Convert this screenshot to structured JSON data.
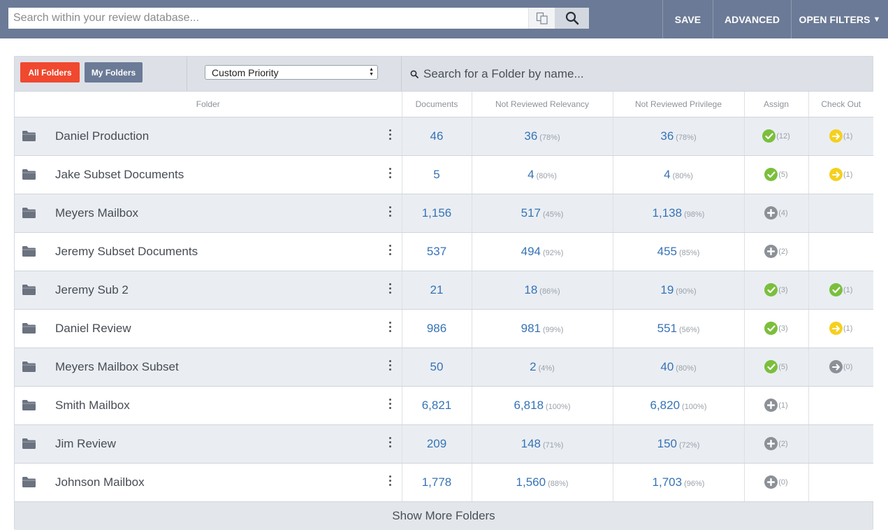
{
  "search": {
    "placeholder": "Search within your review database..."
  },
  "top_actions": {
    "save": "SAVE",
    "advanced": "ADVANCED",
    "open_filters": "OPEN FILTERS"
  },
  "toolbar": {
    "all_folders": "All Folders",
    "my_folders": "My Folders",
    "sort_selected": "Custom Priority",
    "folder_search_placeholder": "Search for a Folder by name..."
  },
  "columns": {
    "folder": "Folder",
    "documents": "Documents",
    "not_reviewed_relevancy": "Not Reviewed Relevancy",
    "not_reviewed_privilege": "Not Reviewed Privilege",
    "assign": "Assign",
    "check_out": "Check Out"
  },
  "rows": [
    {
      "name": "Daniel Production",
      "documents": "46",
      "relevancy": "36",
      "relevancy_pct": "(78%)",
      "privilege": "36",
      "privilege_pct": "(78%)",
      "assign_icon": "check-icon",
      "assign_count": "(12)",
      "checkout_icon": "arrow-right-icon",
      "checkout_count": "(1)"
    },
    {
      "name": "Jake Subset Documents",
      "documents": "5",
      "relevancy": "4",
      "relevancy_pct": "(80%)",
      "privilege": "4",
      "privilege_pct": "(80%)",
      "assign_icon": "check-icon",
      "assign_count": "(5)",
      "checkout_icon": "arrow-right-icon",
      "checkout_count": "(1)"
    },
    {
      "name": "Meyers Mailbox",
      "documents": "1,156",
      "relevancy": "517",
      "relevancy_pct": "(45%)",
      "privilege": "1,138",
      "privilege_pct": "(98%)",
      "assign_icon": "plus-icon",
      "assign_count": "(4)",
      "checkout_icon": "",
      "checkout_count": ""
    },
    {
      "name": "Jeremy Subset Documents",
      "documents": "537",
      "relevancy": "494",
      "relevancy_pct": "(92%)",
      "privilege": "455",
      "privilege_pct": "(85%)",
      "assign_icon": "plus-icon",
      "assign_count": "(2)",
      "checkout_icon": "",
      "checkout_count": ""
    },
    {
      "name": "Jeremy Sub 2",
      "documents": "21",
      "relevancy": "18",
      "relevancy_pct": "(86%)",
      "privilege": "19",
      "privilege_pct": "(90%)",
      "assign_icon": "check-icon",
      "assign_count": "(3)",
      "checkout_icon": "check-icon",
      "checkout_count": "(1)"
    },
    {
      "name": "Daniel Review",
      "documents": "986",
      "relevancy": "981",
      "relevancy_pct": "(99%)",
      "privilege": "551",
      "privilege_pct": "(56%)",
      "assign_icon": "check-icon",
      "assign_count": "(3)",
      "checkout_icon": "arrow-right-icon",
      "checkout_count": "(1)"
    },
    {
      "name": "Meyers Mailbox Subset",
      "documents": "50",
      "relevancy": "2",
      "relevancy_pct": "(4%)",
      "privilege": "40",
      "privilege_pct": "(80%)",
      "assign_icon": "check-icon",
      "assign_count": "(5)",
      "checkout_icon": "arrow-right-gray-icon",
      "checkout_count": "(0)"
    },
    {
      "name": "Smith Mailbox",
      "documents": "6,821",
      "relevancy": "6,818",
      "relevancy_pct": "(100%)",
      "privilege": "6,820",
      "privilege_pct": "(100%)",
      "assign_icon": "plus-icon",
      "assign_count": "(1)",
      "checkout_icon": "",
      "checkout_count": ""
    },
    {
      "name": "Jim Review",
      "documents": "209",
      "relevancy": "148",
      "relevancy_pct": "(71%)",
      "privilege": "150",
      "privilege_pct": "(72%)",
      "assign_icon": "plus-icon",
      "assign_count": "(2)",
      "checkout_icon": "",
      "checkout_count": ""
    },
    {
      "name": "Johnson Mailbox",
      "documents": "1,778",
      "relevancy": "1,560",
      "relevancy_pct": "(88%)",
      "privilege": "1,703",
      "privilege_pct": "(96%)",
      "assign_icon": "plus-icon",
      "assign_count": "(0)",
      "checkout_icon": "",
      "checkout_count": ""
    }
  ],
  "show_more": "Show More Folders",
  "colors": {
    "topbar": "#6b7a96",
    "all_folders_button": "#f0492f",
    "link_blue": "#3673b5",
    "check_green": "#7bbf3c",
    "checkout_yellow": "#f5d01e",
    "neutral_gray": "#8c9097"
  }
}
